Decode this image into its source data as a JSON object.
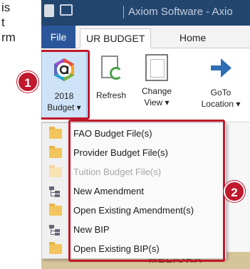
{
  "left_text": [
    "is",
    "t",
    "rm"
  ],
  "titlebar": {
    "title": "Axiom Software - Axio"
  },
  "tabs": {
    "file": "File",
    "active": "UR BUDGET",
    "home": "Home"
  },
  "ribbon": {
    "budget": {
      "line1": "2018",
      "line2": "Budget ▾"
    },
    "refresh": {
      "label": "Refresh"
    },
    "change_view": {
      "line1": "Change",
      "line2": "View ▾"
    },
    "goto": {
      "line1": "GoTo",
      "line2": "Location ▾"
    }
  },
  "menu": {
    "items": [
      {
        "label": "FAO Budget File(s)",
        "icon": "folder-icon",
        "disabled": false
      },
      {
        "label": "Provider Budget File(s)",
        "icon": "folder-icon",
        "disabled": false
      },
      {
        "label": "Tuition Budget File(s)",
        "icon": "folder-icon",
        "disabled": true
      },
      {
        "label": "New Amendment",
        "icon": "hierarchy-icon",
        "disabled": false
      },
      {
        "label": "Open Existing Amendment(s)",
        "icon": "folder-icon",
        "disabled": false
      },
      {
        "label": "New BIP",
        "icon": "hierarchy-icon",
        "disabled": false
      },
      {
        "label": "Open Existing BIP(s)",
        "icon": "folder-icon",
        "disabled": false
      }
    ]
  },
  "callouts": {
    "one": "1",
    "two": "2"
  },
  "stamp": "MELIORA",
  "colors": {
    "accent_red": "#c0182c",
    "file_tab": "#2b579a",
    "titlebar": "#23466e"
  }
}
